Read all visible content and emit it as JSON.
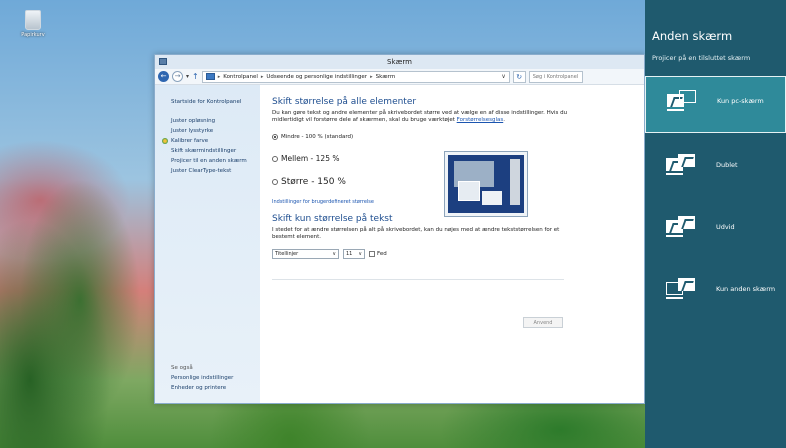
{
  "desktop": {
    "recycle_label": "Papirkurv"
  },
  "window": {
    "title": "Skærm",
    "breadcrumb": [
      "Kontrolpanel",
      "Udseende og personlige indstillinger",
      "Skærm"
    ],
    "search_placeholder": "Søg i Kontrolpanel"
  },
  "sidebar": {
    "home": "Startside for Kontrolpanel",
    "items": [
      "Juster opløsning",
      "Juster lysstyrke",
      "Kalibrer farve",
      "Skift skærmindstillinger",
      "Projicer til en anden skærm",
      "Juster ClearType-tekst"
    ],
    "see_also_header": "Se også",
    "see_also": [
      "Personlige indstillinger",
      "Enheder og printere"
    ]
  },
  "main": {
    "heading1": "Skift størrelse på alle elementer",
    "desc1": "Du kan gøre tekst og andre elementer på skrivebordet større ved at vælge en af disse indstillinger. Hvis du midlertidigt vil forstørre dele af skærmen, skal du bruge værktøjet ",
    "desc1_link": "Forstørrelsesglas",
    "options": [
      "Mindre - 100 % (standard)",
      "Mellem - 125 %",
      "Større - 150 %"
    ],
    "selected_option": 0,
    "custom_link": "Indstillinger for brugerdefineret størrelse",
    "heading2": "Skift kun størrelse på tekst",
    "desc2": "I stedet for at ændre størrelsen på alt på skrivebordet, kan du nøjes med at ændre tekststørrelsen for et bestemt element.",
    "element_select": "Titellinjer",
    "size_select": "11",
    "bold_label": "Fed",
    "apply_button": "Anvend"
  },
  "charm": {
    "title": "Anden skærm",
    "subtitle": "Projicer på en tilsluttet skærm",
    "options": [
      "Kun pc-skærm",
      "Dublet",
      "Udvid",
      "Kun anden skærm"
    ],
    "selected_index": 0
  },
  "colors": {
    "charm_bg": "#1f5a6e",
    "charm_selected": "#2f8a9a",
    "link_blue": "#1b55b0",
    "heading_blue": "#1d4d8f"
  }
}
